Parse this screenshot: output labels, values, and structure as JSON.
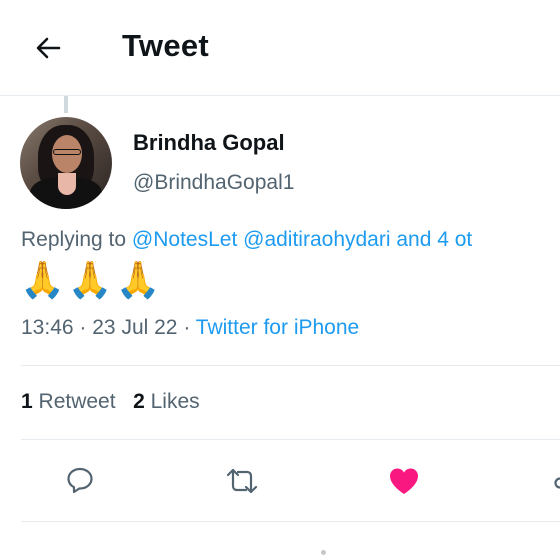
{
  "header": {
    "title": "Tweet",
    "back_icon": "arrow-left-icon"
  },
  "tweet": {
    "author": {
      "display_name": "Brindha Gopal",
      "handle": "@BrindhaGopal1"
    },
    "replying": {
      "prefix": "Replying to ",
      "mention_1": "@NotesLet",
      "mention_2": "@aditiraohydari",
      "suffix": " and 4 ot"
    },
    "emojis": [
      "🙏",
      "🙏",
      "🙏"
    ],
    "time": "13:46",
    "separator": "·",
    "date": "23 Jul 22",
    "source": "Twitter for iPhone"
  },
  "stats": {
    "retweets_count": "1",
    "retweets_label": "Retweet",
    "likes_count": "2",
    "likes_label": "Likes"
  },
  "actions": {
    "reply_icon": "reply-icon",
    "retweet_icon": "retweet-icon",
    "like_icon": "heart-icon",
    "share_icon": "share-icon",
    "liked": true
  },
  "colors": {
    "accent": "#1d9bf0",
    "like": "#f91880",
    "text_primary": "#0f1419",
    "text_secondary": "#536471"
  }
}
